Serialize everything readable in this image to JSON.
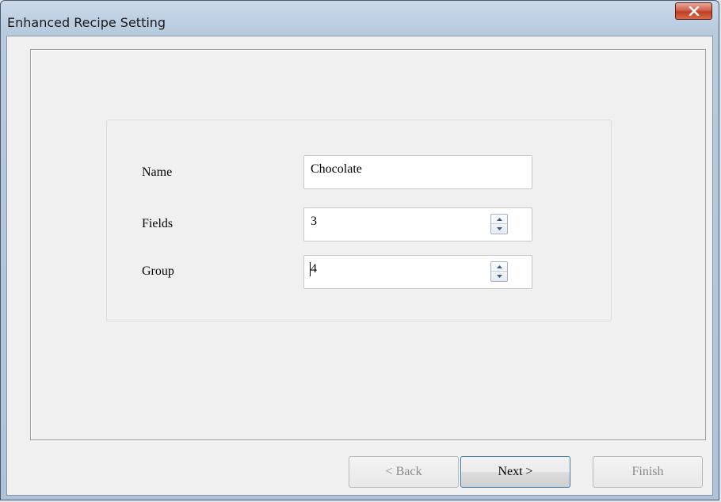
{
  "window": {
    "title": "Enhanced Recipe Setting"
  },
  "form": {
    "name": {
      "label": "Name",
      "value": "Chocolate"
    },
    "fields": {
      "label": "Fields",
      "value": "3"
    },
    "group": {
      "label": "Group",
      "value": "4"
    }
  },
  "buttons": {
    "back": "< Back",
    "next": "Next >",
    "finish": "Finish"
  },
  "icons": {
    "close": "close-icon",
    "spin_up": "spin-up-icon",
    "spin_down": "spin-down-icon"
  }
}
